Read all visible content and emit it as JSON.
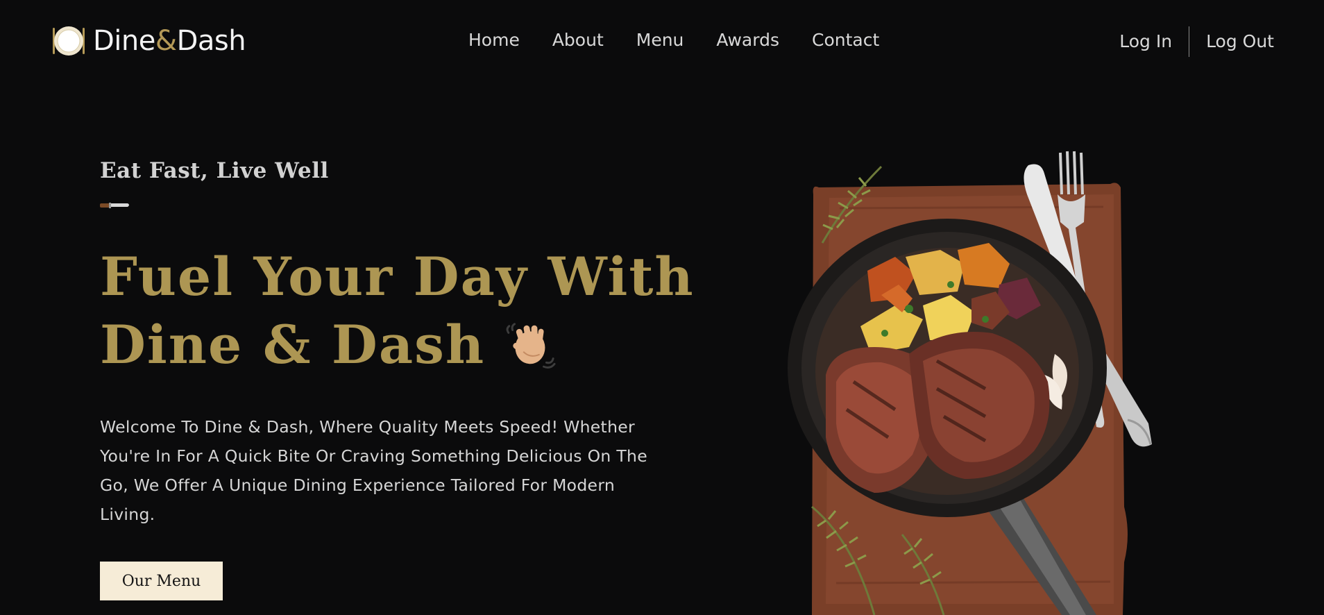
{
  "brand": {
    "name_part1": "Dine",
    "name_amp": "&",
    "name_part2": "Dash",
    "logo_icon": "plate-icon"
  },
  "nav": {
    "links": [
      "Home",
      "About",
      "Menu",
      "Awards",
      "Contact"
    ]
  },
  "auth": {
    "login_label": "Log In",
    "logout_label": "Log Out"
  },
  "hero": {
    "tagline": "Eat Fast, Live Well",
    "divider_icon": "knife-icon",
    "headline_line1": "Fuel Your Day With",
    "headline_line2": "Dine & Dash",
    "headline_emoji": "waving-hand-icon",
    "intro": "Welcome To Dine & Dash, Where Quality Meets Speed! Whether You're In For A Quick Bite Or Craving Something Delicious On The Go, We Offer A Unique Dining Experience Tailored For Modern Living.",
    "cta_label": "Our Menu",
    "image_subject": "steak-skillet-image"
  },
  "colors": {
    "background": "#0b0b0c",
    "accent_gold": "#ad9653",
    "button_cream": "#f6ecd7",
    "text_light": "#d6d6d6"
  }
}
